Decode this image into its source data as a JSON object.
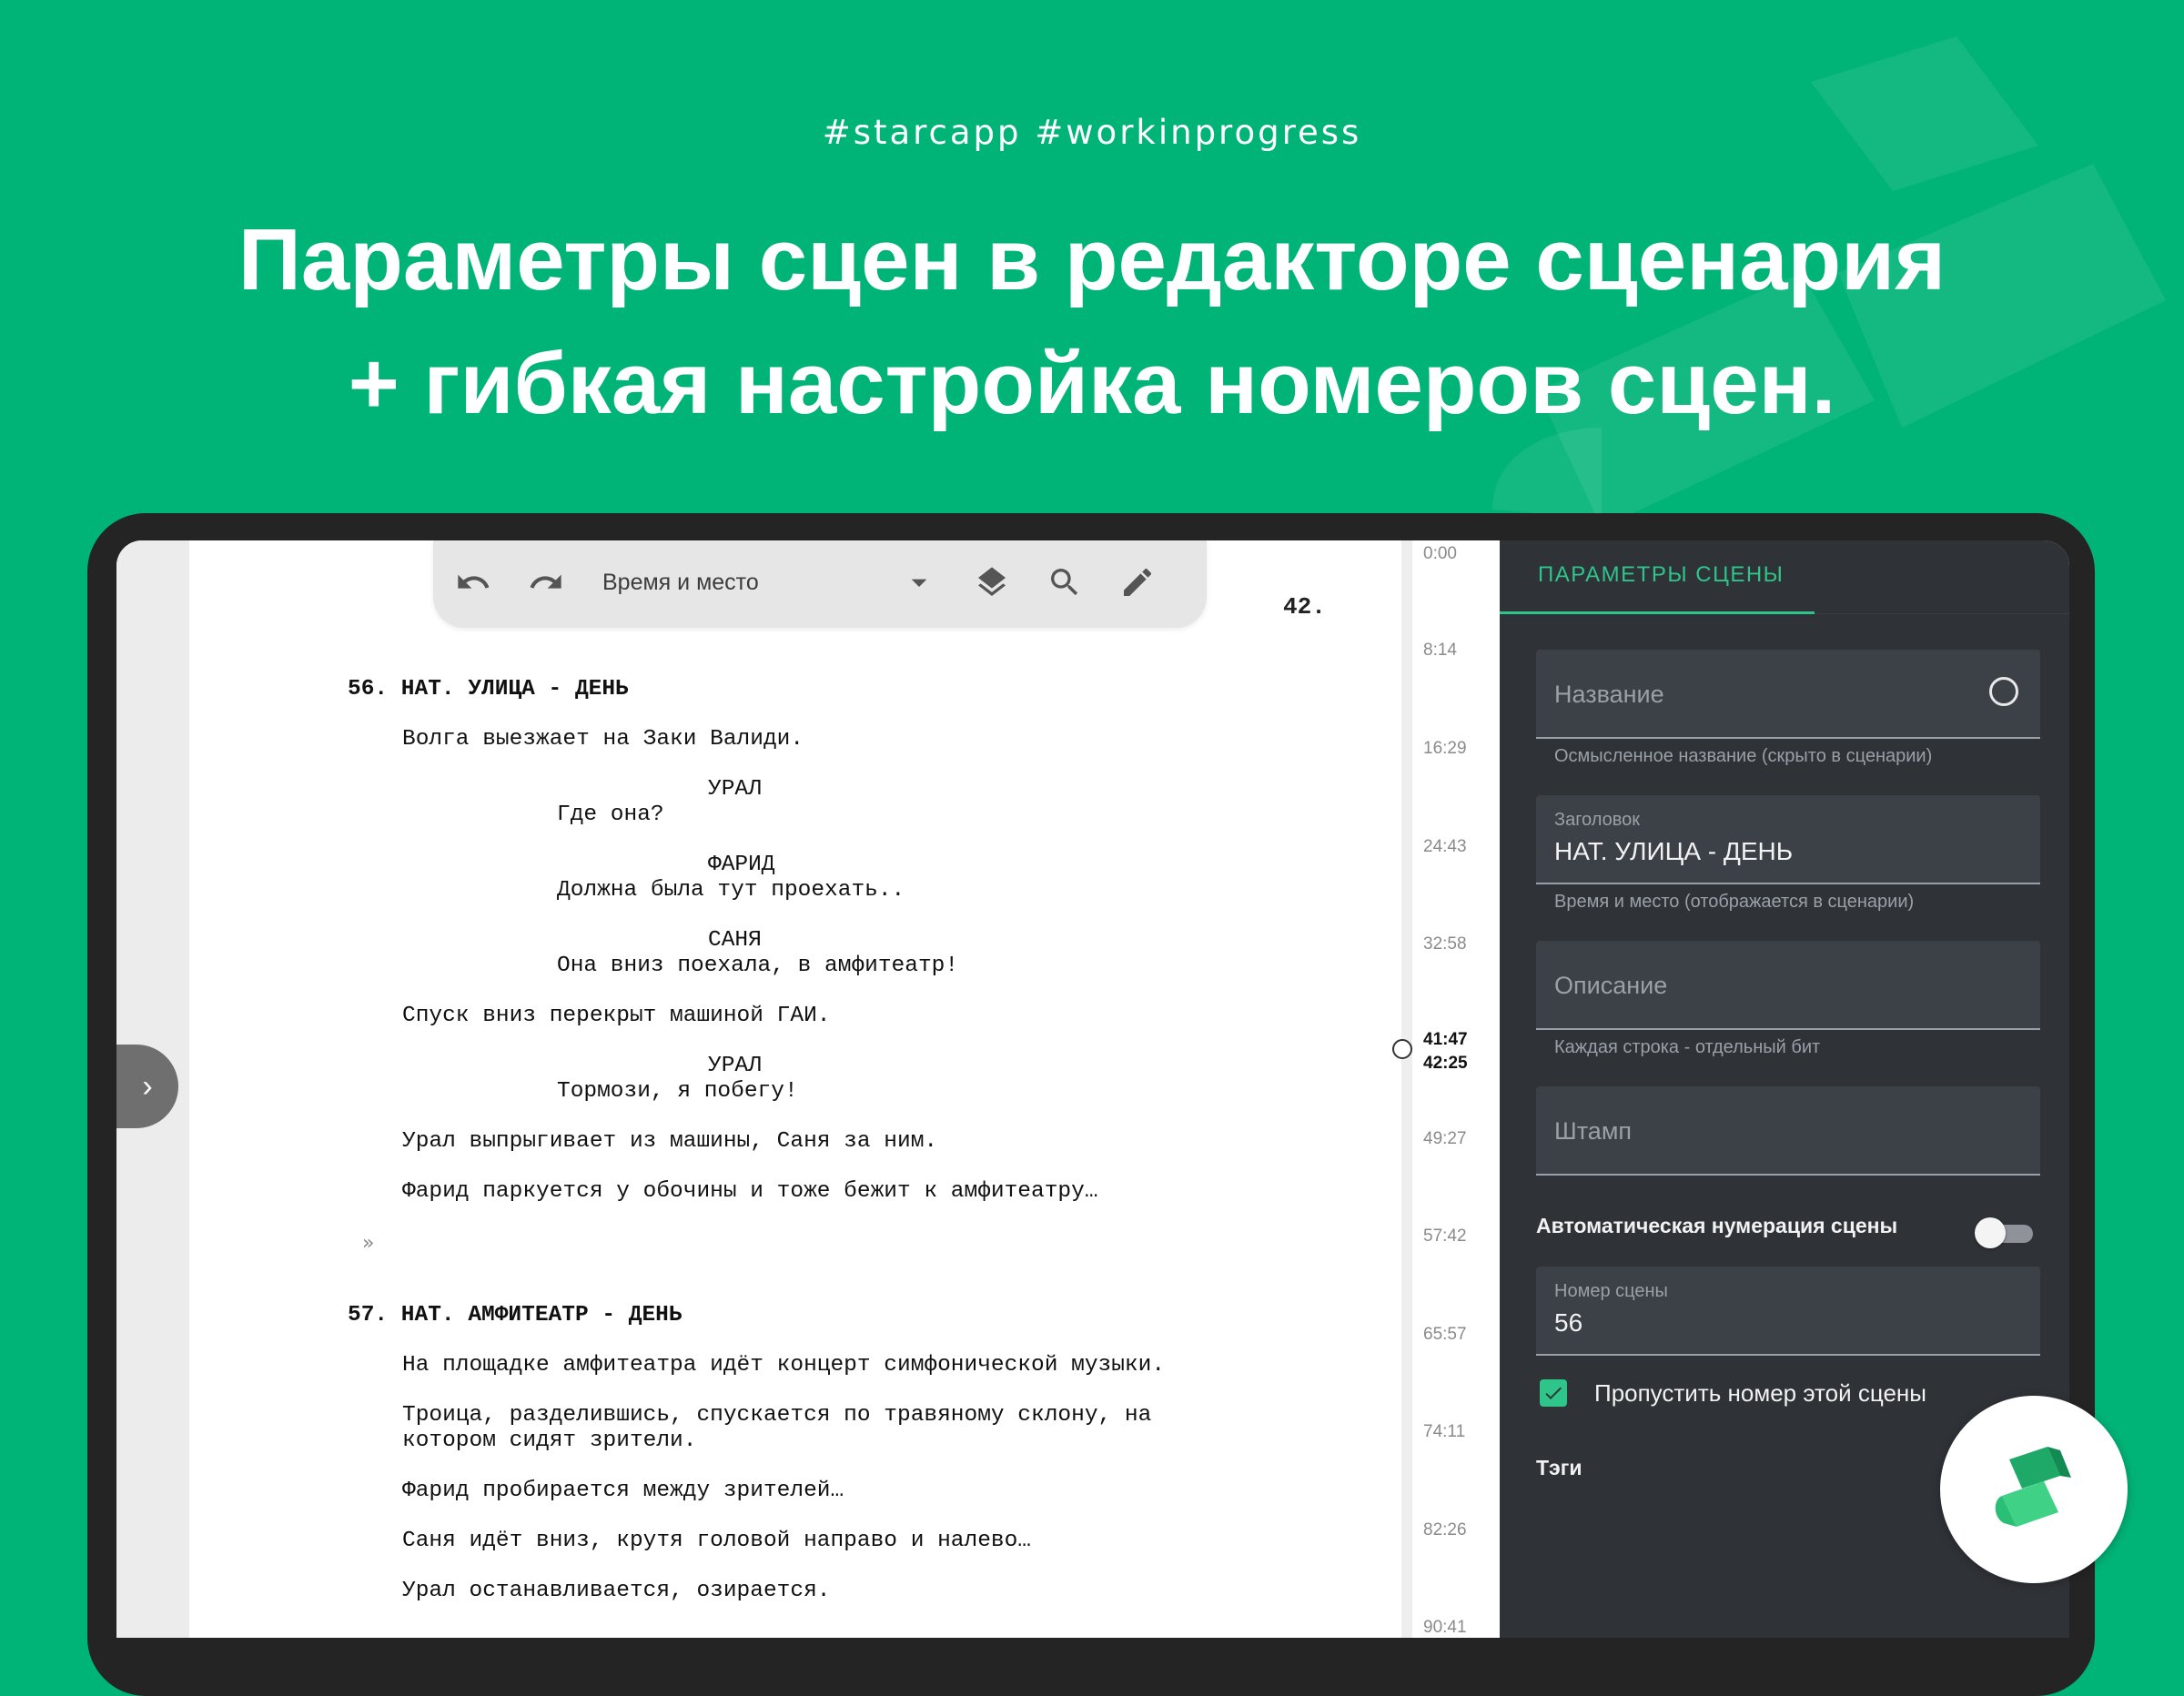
{
  "banner": {
    "hashtags": "#starcapp  #workinprogress",
    "headline_line1": "Параметры сцен в редакторе сценария",
    "headline_line2": "+ гибкая настройка номеров сцен."
  },
  "toolbar": {
    "undo_icon": "undo-icon",
    "redo_icon": "redo-icon",
    "style_selector_value": "Время и место",
    "dropdown_icon": "caret-down-icon",
    "layers_icon": "layers-icon",
    "search_icon": "search-icon",
    "pen_icon": "pen-icon"
  },
  "editor": {
    "page_number": "42.",
    "continued_marker": "»",
    "lines": [
      {
        "kind": "scene",
        "text": "56. НАТ. УЛИЦА - ДЕНЬ"
      },
      {
        "kind": "action",
        "text": "Волга выезжает на Заки Валиди."
      },
      {
        "kind": "character",
        "text": "УРАЛ"
      },
      {
        "kind": "dialogue",
        "text": "Где она?"
      },
      {
        "kind": "character",
        "text": "ФАРИД"
      },
      {
        "kind": "dialogue",
        "text": "Должна была тут проехать.."
      },
      {
        "kind": "character",
        "text": "САНЯ"
      },
      {
        "kind": "dialogue",
        "text": "Она вниз поехала, в амфитеатр!"
      },
      {
        "kind": "action",
        "text": "Спуск вниз перекрыт машиной ГАИ."
      },
      {
        "kind": "character",
        "text": "УРАЛ"
      },
      {
        "kind": "dialogue",
        "text": "Тормози, я побегу!"
      },
      {
        "kind": "action",
        "text": "Урал выпрыгивает из машины, Саня за ним."
      },
      {
        "kind": "action",
        "text": "Фарид паркуется у обочины и тоже бежит к амфитеатру…"
      },
      {
        "kind": "scene",
        "text": "57. НАТ. АМФИТЕАТР - ДЕНЬ"
      },
      {
        "kind": "action",
        "text": "На площадке амфитеатра идёт концерт симфонической музыки."
      },
      {
        "kind": "action",
        "text": "Троица, разделившись, спускается по травяному склону, на"
      },
      {
        "kind": "action",
        "text": "котором сидят зрители."
      },
      {
        "kind": "action",
        "text": "Фарид пробирается между зрителей…"
      },
      {
        "kind": "action",
        "text": "Саня идёт вниз, крутя головой направо и налево…"
      },
      {
        "kind": "action",
        "text": "Урал останавливается, озирается."
      }
    ]
  },
  "timeline": {
    "marks": [
      "0:00",
      "8:14",
      "16:29",
      "24:43",
      "32:58",
      "49:27",
      "57:42",
      "65:57",
      "74:11",
      "82:26",
      "90:41"
    ],
    "current_start": "41:47",
    "current_end": "42:25"
  },
  "panel": {
    "tab_label": "ПАРАМЕТРЫ СЦЕНЫ",
    "name_placeholder": "Название",
    "name_helper": "Осмысленное название (скрыто в сценарии)",
    "heading_label": "Заголовок",
    "heading_value": "НАТ. УЛИЦА - ДЕНЬ",
    "heading_helper": "Время и место (отображается в сценарии)",
    "description_placeholder": "Описание",
    "description_helper": "Каждая строка - отдельный бит",
    "stamp_placeholder": "Штамп",
    "auto_numbering_label": "Автоматическая нумерация сцены",
    "auto_numbering_on": false,
    "scene_number_label": "Номер сцены",
    "scene_number_value": "56",
    "skip_number_label": "Пропустить номер этой сцены",
    "skip_number_checked": true,
    "tags_label": "Тэги"
  },
  "colors": {
    "background": "#00b377",
    "panel": "#2f3237",
    "accent": "#2fc58a"
  }
}
